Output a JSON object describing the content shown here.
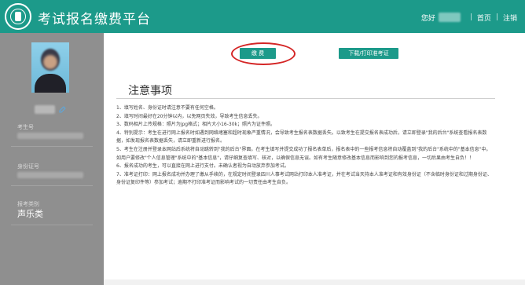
{
  "header": {
    "title": "考试报名缴费平台",
    "hello": "您好",
    "links": [
      "首页",
      "注销"
    ],
    "accent": "#1c9a8a"
  },
  "sidebar": {
    "fields": [
      {
        "label": "考生号"
      },
      {
        "label": "身份证号"
      },
      {
        "label": "报考类别",
        "value": "声乐类"
      }
    ],
    "edit_icon": "edit-icon"
  },
  "main": {
    "buttons": {
      "pay": "缴 费",
      "download": "下载/打印准考证"
    },
    "highlight_color": "#d42525",
    "notice_title": "注意事项",
    "notices": [
      "1、填写姓名、身份证时请注意不要有任何空格。",
      "2、填写时间最好在20分钟以内，以免网页失效，导致考生信息丢失。",
      "3、数码相片上传规格：照片为jpg格式；相片大小16-30k；照片为证件照。",
      "4、特别提示：考生在进行网上报名时如遇到网络堵塞和超时现象严重情况，会导致考生报名表数据丢失。以致考生在提交报名表成功后，请立即登录\"我的后台\"系统查看报名表数据，如发现报名表数据丢失，请立即重新进行报名。",
      "5、考生在注册并登录本网站后系统将自动跳转到\"我的后台\"界面。在考生填写并提交成功了报名表单后，报名表中的一些报考信息将自动覆盖到\"我的后台\"系统中的\"基本信息\"中。如用户要修改\"个人信息管理\"系统中的\"基本信息\"，请仔细复查填写、核对，以确保信息无误。如有考生随意修改基本信息而影响到您的报考信息，一切后果由考生自负！！",
      "6、报名成功的考生，可以直接在网上进行支付。未确认者视为自动放弃参加考试。",
      "7、准考证打印：网上报名成功并办理了缴从手续的，在规定时间登录四川人事考试网站打印本人准考证，并在考试当天持本人准考证和有效身份证（不含临时身份证和过期身份证、身份证复印件等）参加考试；逾期不打印准考证而影响考试的一切责任由考生自负。"
    ]
  }
}
